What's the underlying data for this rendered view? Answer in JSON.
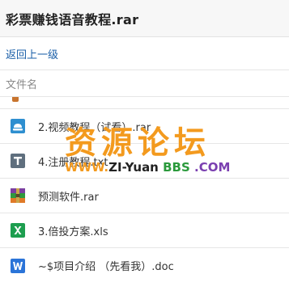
{
  "header": {
    "title": "彩票赚钱语音教程.rar"
  },
  "nav": {
    "back_label": "返回上一级"
  },
  "columns": {
    "filename_label": "文件名"
  },
  "files": [
    {
      "name": "2.视频教程（试看）.rar",
      "icon": "cloud-drive-icon"
    },
    {
      "name": "4.注册教程.txt",
      "icon": "text-file-icon"
    },
    {
      "name": "预测软件.rar",
      "icon": "archive-file-icon"
    },
    {
      "name": "3.倍投方案.xls",
      "icon": "excel-file-icon"
    },
    {
      "name": "~$项目介绍 （先看我）.doc",
      "icon": "word-file-icon"
    }
  ],
  "watermark": {
    "cn_text": "资源论坛",
    "en_part1": "WWW.",
    "en_part2": "ZI",
    "en_part3": "-Yuan",
    "en_part4": "BBS",
    "en_part5": ".COM"
  },
  "colors": {
    "link": "#1a5fa8",
    "watermark_orange": "#f39a1e",
    "excel_green": "#1d9e4f",
    "word_blue": "#2b74d8",
    "text_gray": "#5f6f7e"
  }
}
